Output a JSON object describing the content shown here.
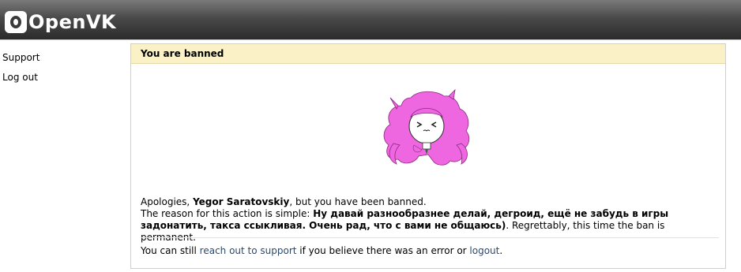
{
  "header": {
    "logo_text": "OpenVK"
  },
  "sidebar": {
    "items": [
      {
        "label": "Support"
      },
      {
        "label": "Log out"
      }
    ]
  },
  "ban_page": {
    "title": "You are banned",
    "apology_prefix": "Apologies, ",
    "user_name": "Yegor Saratovskiy",
    "apology_suffix": ", but you have been banned.",
    "reason_prefix": "The reason for this action is simple: ",
    "reason": "Ну давай разнообразнее делай, дегроид, ещё не забудь в игры задонатить, такса ссыкливая. Очень рад, что с вами не общаюсь)",
    "reason_suffix": ". Regrettably, this time the ban is permanent.",
    "footer_prefix": "You can still ",
    "support_link": "reach out to support",
    "footer_middle": " if you believe there was an error or ",
    "logout_link": "logout",
    "footer_suffix": "."
  },
  "colors": {
    "header_dark": "#2b2b2b",
    "title_bar": "#faf1c6",
    "link": "#2a4a6d",
    "hair": "#ee66e0"
  }
}
